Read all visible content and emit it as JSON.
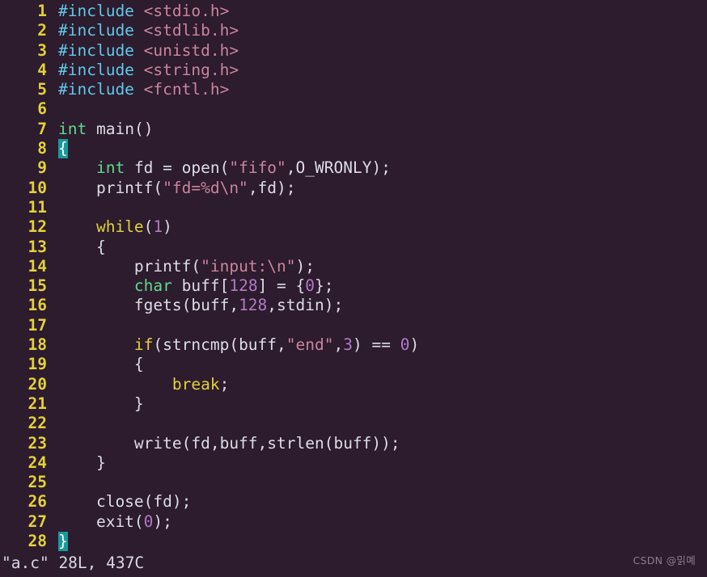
{
  "editor": {
    "name": "vim",
    "filename": "a.c",
    "background_color": "#2d1b2e",
    "linenumber_color": "#e2d23b",
    "cursor_color": "#179a9a",
    "default_text_color": "#d8d8e0",
    "total_lines": 28
  },
  "colors": {
    "preproc": "#5fc9e8",
    "header": "#c9859c",
    "type": "#5fd98a",
    "statement": "#e2d23b",
    "string": "#c9859c",
    "number": "#b07bc4",
    "identifier": "#ddddE4"
  },
  "code": {
    "lines": [
      {
        "num": "1",
        "tokens": [
          {
            "t": "#include ",
            "c": "pre"
          },
          {
            "t": "<stdio.h>",
            "c": "hdr"
          }
        ]
      },
      {
        "num": "2",
        "tokens": [
          {
            "t": "#include ",
            "c": "pre"
          },
          {
            "t": "<stdlib.h>",
            "c": "hdr"
          }
        ]
      },
      {
        "num": "3",
        "tokens": [
          {
            "t": "#include ",
            "c": "pre"
          },
          {
            "t": "<unistd.h>",
            "c": "hdr"
          }
        ]
      },
      {
        "num": "4",
        "tokens": [
          {
            "t": "#include ",
            "c": "pre"
          },
          {
            "t": "<string.h>",
            "c": "hdr"
          }
        ]
      },
      {
        "num": "5",
        "tokens": [
          {
            "t": "#include ",
            "c": "pre"
          },
          {
            "t": "<fcntl.h>",
            "c": "hdr"
          }
        ]
      },
      {
        "num": "6",
        "tokens": []
      },
      {
        "num": "7",
        "tokens": [
          {
            "t": "int",
            "c": "type"
          },
          {
            "t": " ",
            "c": "id"
          },
          {
            "t": "main",
            "c": "id"
          },
          {
            "t": "()",
            "c": "id"
          }
        ]
      },
      {
        "num": "8",
        "tokens": [
          {
            "t": "{",
            "c": "cursor"
          }
        ]
      },
      {
        "num": "9",
        "tokens": [
          {
            "t": "    ",
            "c": "id"
          },
          {
            "t": "int",
            "c": "type"
          },
          {
            "t": " fd = open(",
            "c": "id"
          },
          {
            "t": "\"fifo\"",
            "c": "str"
          },
          {
            "t": ",",
            "c": "id"
          },
          {
            "t": "O_WRONLY",
            "c": "const"
          },
          {
            "t": ");",
            "c": "id"
          }
        ]
      },
      {
        "num": "10",
        "tokens": [
          {
            "t": "    printf(",
            "c": "id"
          },
          {
            "t": "\"fd=%d\\n\"",
            "c": "str"
          },
          {
            "t": ",fd);",
            "c": "id"
          }
        ]
      },
      {
        "num": "11",
        "tokens": []
      },
      {
        "num": "12",
        "tokens": [
          {
            "t": "    ",
            "c": "id"
          },
          {
            "t": "while",
            "c": "stmt"
          },
          {
            "t": "(",
            "c": "id"
          },
          {
            "t": "1",
            "c": "num"
          },
          {
            "t": ")",
            "c": "id"
          }
        ]
      },
      {
        "num": "13",
        "tokens": [
          {
            "t": "    {",
            "c": "id"
          }
        ]
      },
      {
        "num": "14",
        "tokens": [
          {
            "t": "        printf(",
            "c": "id"
          },
          {
            "t": "\"input:\\n\"",
            "c": "str"
          },
          {
            "t": ");",
            "c": "id"
          }
        ]
      },
      {
        "num": "15",
        "tokens": [
          {
            "t": "        ",
            "c": "id"
          },
          {
            "t": "char",
            "c": "type"
          },
          {
            "t": " buff[",
            "c": "id"
          },
          {
            "t": "128",
            "c": "num"
          },
          {
            "t": "] = {",
            "c": "id"
          },
          {
            "t": "0",
            "c": "num"
          },
          {
            "t": "};",
            "c": "id"
          }
        ]
      },
      {
        "num": "16",
        "tokens": [
          {
            "t": "        fgets(buff,",
            "c": "id"
          },
          {
            "t": "128",
            "c": "num"
          },
          {
            "t": ",stdin);",
            "c": "id"
          }
        ]
      },
      {
        "num": "17",
        "tokens": []
      },
      {
        "num": "18",
        "tokens": [
          {
            "t": "        ",
            "c": "id"
          },
          {
            "t": "if",
            "c": "stmt"
          },
          {
            "t": "(strncmp(buff,",
            "c": "id"
          },
          {
            "t": "\"end\"",
            "c": "str"
          },
          {
            "t": ",",
            "c": "id"
          },
          {
            "t": "3",
            "c": "num"
          },
          {
            "t": ") == ",
            "c": "id"
          },
          {
            "t": "0",
            "c": "num"
          },
          {
            "t": ")",
            "c": "id"
          }
        ]
      },
      {
        "num": "19",
        "tokens": [
          {
            "t": "        {",
            "c": "id"
          }
        ]
      },
      {
        "num": "20",
        "tokens": [
          {
            "t": "            ",
            "c": "id"
          },
          {
            "t": "break",
            "c": "stmt"
          },
          {
            "t": ";",
            "c": "id"
          }
        ]
      },
      {
        "num": "21",
        "tokens": [
          {
            "t": "        }",
            "c": "id"
          }
        ]
      },
      {
        "num": "22",
        "tokens": []
      },
      {
        "num": "23",
        "tokens": [
          {
            "t": "        write(fd,buff,strlen(buff));",
            "c": "id"
          }
        ]
      },
      {
        "num": "24",
        "tokens": [
          {
            "t": "    }",
            "c": "id"
          }
        ]
      },
      {
        "num": "25",
        "tokens": []
      },
      {
        "num": "26",
        "tokens": [
          {
            "t": "    close(fd);",
            "c": "id"
          }
        ]
      },
      {
        "num": "27",
        "tokens": [
          {
            "t": "    exit(",
            "c": "id"
          },
          {
            "t": "0",
            "c": "num"
          },
          {
            "t": ");",
            "c": "id"
          }
        ]
      },
      {
        "num": "28",
        "tokens": [
          {
            "t": "}",
            "c": "cursor"
          }
        ]
      }
    ]
  },
  "statusline": {
    "text": "\"a.c\" 28L, 437C"
  },
  "watermark": {
    "text": "CSDN @밁몌"
  }
}
